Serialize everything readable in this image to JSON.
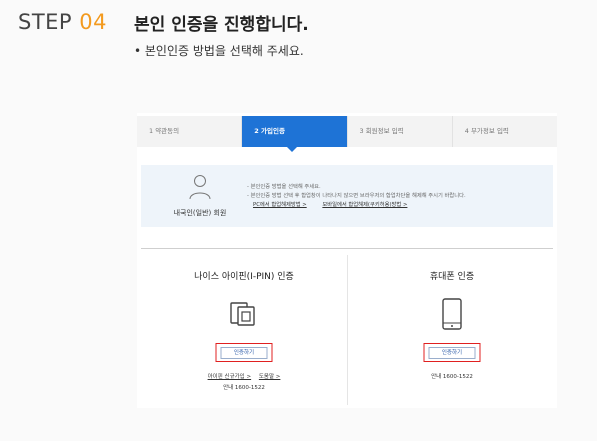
{
  "header": {
    "step_label": "STEP",
    "step_number": "04",
    "title": "본인 인증을 진행합니다.",
    "subtitle": "• 본인인증 방법을 선택해 주세요."
  },
  "steps": [
    {
      "label": "1 약관동의",
      "active": false
    },
    {
      "label": "2 가입인증",
      "active": true
    },
    {
      "label": "3 회원정보 입력",
      "active": false
    },
    {
      "label": "4 부가정보 입력",
      "active": false
    }
  ],
  "member_type": {
    "label": "내국인(일반) 회원",
    "line1": "- 본인인증 방법을 선택해 주세요.",
    "line2": "- 본인인증 방법 선택 후 합업창이 나타나지 않으면 브라우저의 합업차단을 해제해 주시기 바랍니다.",
    "link_pc": "PC에서 합업해제방법 >",
    "link_mobile": "모바일에서 합업해제(쿠키허용)방법 >"
  },
  "ipin": {
    "title": "나이스 아이핀(I-PIN) 인증",
    "button_label": "인증하기",
    "link_signup": "아이핀 신규가입 >",
    "link_help": "도움말 >",
    "phone": "안내 1600-1522"
  },
  "mobile": {
    "title": "휴대폰 인증",
    "button_label": "인증하기",
    "phone": "안내 1600-1522"
  },
  "colors": {
    "accent_orange": "#f39a1e",
    "active_step_blue": "#1e73d6",
    "highlight_red": "#e02020"
  }
}
